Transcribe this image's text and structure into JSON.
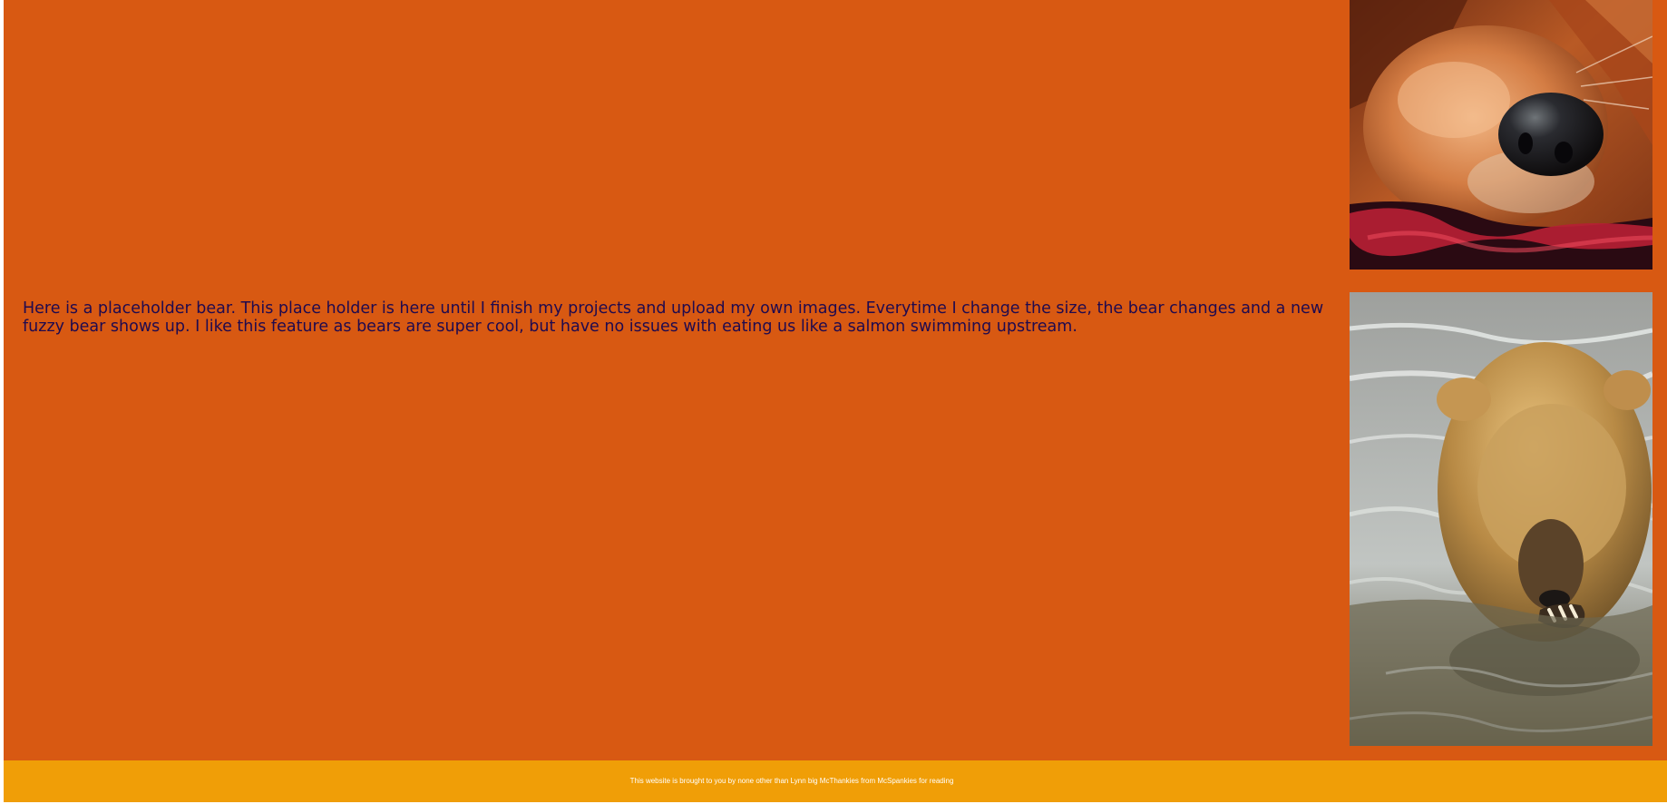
{
  "content": {
    "paragraph": "Here is a placeholder bear. This place holder is here until I finish my projects and upload my own images. Everytime I change the size, the bear changes and a new fuzzy bear shows up. I like this feature as bears are super cool, but have no issues with eating us like a salmon swimming upstream."
  },
  "images": {
    "top": {
      "icon": "dog-photo"
    },
    "bear": {
      "icon": "bear-photo"
    }
  },
  "footer": {
    "text": "This website is brought to you by none other than Lynn big McThankies from McSpankies for reading"
  },
  "colors": {
    "main_background": "#d85912",
    "footer_background": "#f09e07",
    "paragraph_text": "#1f0a4f",
    "footer_text": "#ffffff"
  }
}
